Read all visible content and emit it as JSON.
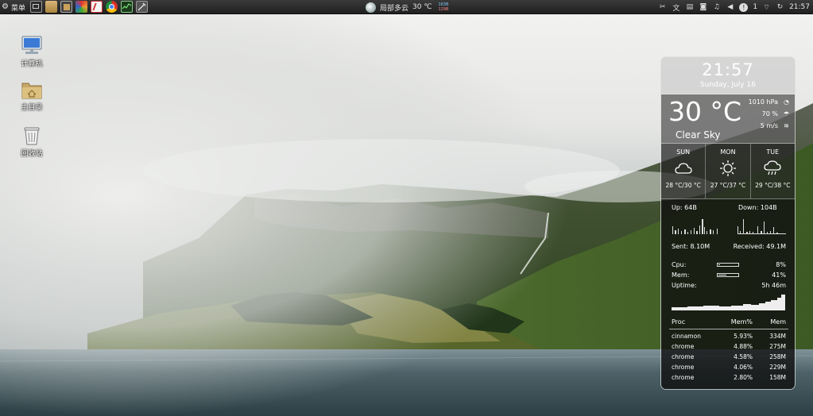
{
  "topbar": {
    "menu_label": "菜单",
    "weather_city": "局部多云",
    "weather_temp": "30 ℃",
    "net_up": "163B",
    "net_down": "129B",
    "notification_count": "1",
    "clock": "21:57",
    "launchers": [
      "terminal",
      "files",
      "taskbar-app",
      "color-app",
      "text-editor",
      "chrome",
      "monitor",
      "settings"
    ],
    "tray_icons": [
      "tools-icon",
      "translate-icon",
      "note-icon",
      "camera-icon",
      "music-icon",
      "volume-icon",
      "alert-icon",
      "wifi-icon",
      "update-icon"
    ]
  },
  "desktop": {
    "icons": [
      {
        "name": "computer-icon",
        "label": "计算机"
      },
      {
        "name": "home-folder-icon",
        "label": "主目录"
      },
      {
        "name": "trash-icon",
        "label": "回收站"
      }
    ]
  },
  "widget": {
    "time": "21:57",
    "date": "Sunday, July 16",
    "temperature": "30 °C",
    "condition": "Clear Sky",
    "pressure": "1010 hPa",
    "humidity": "70 %",
    "wind": "5 m/s",
    "forecast": [
      {
        "day": "SUN",
        "range": "28 °C/30 °C",
        "icon": "cloud-icon"
      },
      {
        "day": "MON",
        "range": "27 °C/37 °C",
        "icon": "sun-icon"
      },
      {
        "day": "TUE",
        "range": "29 °C/38 °C",
        "icon": "rain-cloud-icon"
      }
    ],
    "net": {
      "up": "Up: 64B",
      "down": "Down: 104B",
      "sent": "Sent: 8.10M",
      "received": "Received: 49.1M"
    },
    "system": {
      "cpu_label": "Cpu:",
      "cpu_value": "8%",
      "cpu_fraction": 0.08,
      "mem_label": "Mem:",
      "mem_value": "41%",
      "mem_fraction": 0.41,
      "uptime_label": "Uptime:",
      "uptime_value": "5h 46m"
    },
    "proc_headers": [
      "Proc",
      "Mem%",
      "Mem"
    ],
    "processes": [
      {
        "name": "cinnamon",
        "pct": "5.93%",
        "mem": "334M"
      },
      {
        "name": "chrome",
        "pct": "4.88%",
        "mem": "275M"
      },
      {
        "name": "chrome",
        "pct": "4.58%",
        "mem": "258M"
      },
      {
        "name": "chrome",
        "pct": "4.06%",
        "mem": "229M"
      },
      {
        "name": "chrome",
        "pct": "2.80%",
        "mem": "158M"
      }
    ]
  }
}
